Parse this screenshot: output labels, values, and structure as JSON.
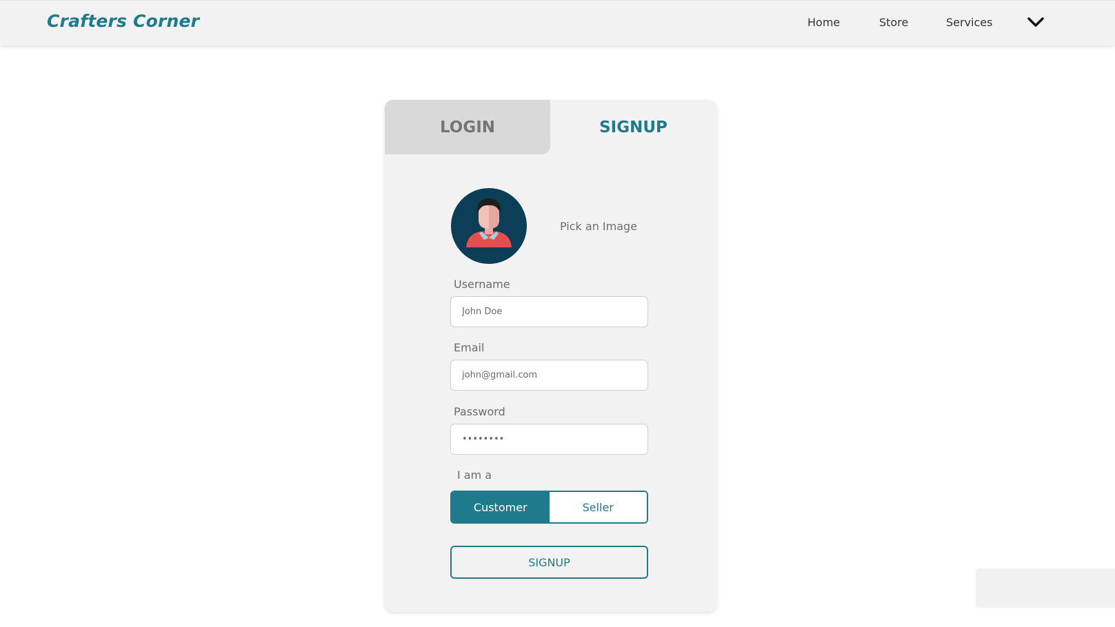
{
  "navbar": {
    "brand": "Crafters Corner",
    "links": [
      {
        "label": "Home"
      },
      {
        "label": "Store"
      },
      {
        "label": "Services"
      }
    ],
    "dropdown_icon": "chevron-down-icon"
  },
  "auth_card": {
    "tabs": [
      {
        "label": "LOGIN",
        "active": false
      },
      {
        "label": "SIGNUP",
        "active": true
      }
    ],
    "avatar_icon": "user-avatar-icon",
    "pick_image_label": "Pick an Image",
    "fields": {
      "username": {
        "label": "Username",
        "placeholder": "John Doe"
      },
      "email": {
        "label": "Email",
        "placeholder": "john@gmail.com"
      },
      "password": {
        "label": "Password",
        "placeholder": "••••••••"
      }
    },
    "role": {
      "label": "I am a",
      "options": [
        "Customer",
        "Seller"
      ],
      "selected": "Customer"
    },
    "submit_label": "SIGNUP"
  },
  "colors": {
    "accent": "#1f7a8c",
    "avatar_bg": "#0d3e57",
    "card_bg": "#f2f2f2",
    "inactive_tab": "#d9d9d9"
  }
}
